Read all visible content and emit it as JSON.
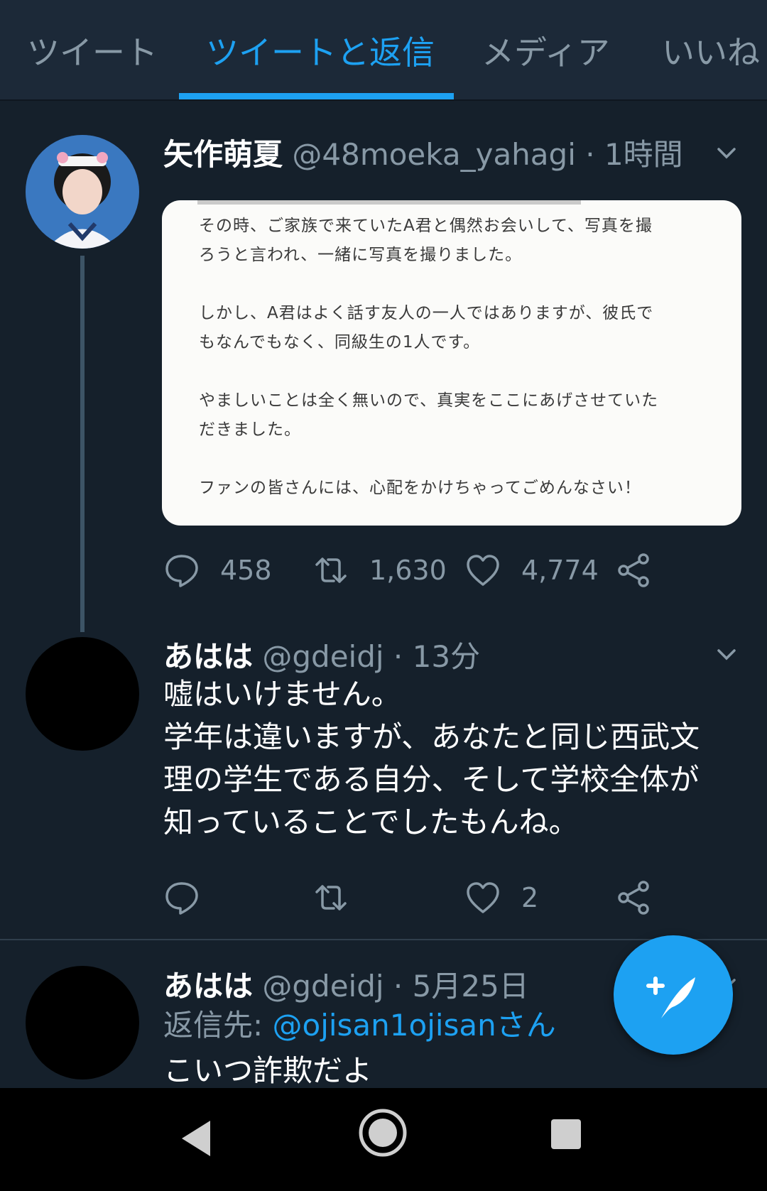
{
  "tabs": [
    {
      "label": "ツイート",
      "active": false
    },
    {
      "label": "ツイートと返信",
      "active": true
    },
    {
      "label": "メディア",
      "active": false
    },
    {
      "label": "いいね",
      "active": false
    }
  ],
  "tweet1": {
    "name": "矢作萌夏",
    "handle": "@48moeka_yahagi",
    "time": "1時間",
    "image_lines": [
      "その時、ご家族で来ていたA君と偶然お会いして、写真を撮",
      "ろうと言われ、一緒に写真を撮りました。",
      "しかし、A君はよく話す友人の一人ではありますが、彼氏で",
      "もなんでもなく、同級生の1人です。",
      "やましいことは全く無いので、真実をここにあげさせていた",
      "だきました。",
      "ファンの皆さんには、心配をかけちゃってごめんなさい！"
    ],
    "replies": "458",
    "retweets": "1,630",
    "likes": "4,774"
  },
  "tweet2": {
    "name": "あはは",
    "handle": "@gdeidj",
    "time": "13分",
    "text_lines": [
      "嘘はいけません。",
      "学年は違いますが、あなたと同じ西武文",
      "理の学生である自分、そして学校全体が",
      "知っていることでしたもんね。"
    ],
    "likes": "2"
  },
  "tweet3": {
    "name": "あはは",
    "handle": "@gdeidj",
    "time": "5月25日",
    "replying_label": "返信先:",
    "replying_to": "@ojisan1ojisanさん",
    "text": "こいつ詐欺だよ"
  },
  "colors": {
    "background": "#15202b",
    "accent": "#1da1f2",
    "secondary_text": "#8899a6"
  }
}
